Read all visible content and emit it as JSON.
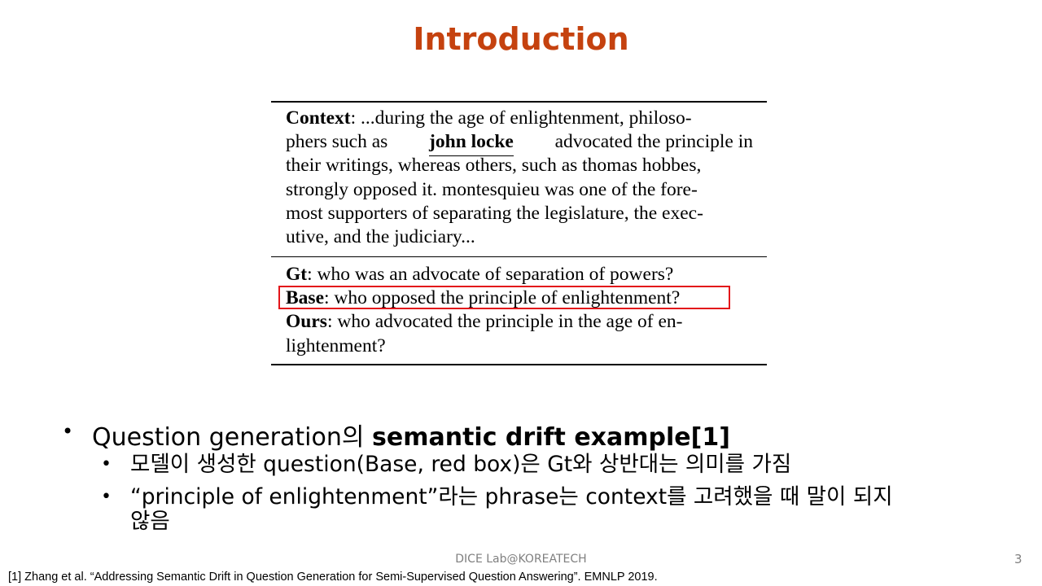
{
  "slide": {
    "title": "Introduction",
    "footer": "DICE Lab@KOREATECH",
    "page_number": "3",
    "reference": "[1] Zhang et al. “Addressing Semantic Drift in Question Generation for Semi-Supervised Question Answering”. EMNLP 2019."
  },
  "figure": {
    "context_label": "Context",
    "context_lines": [
      ": ...during the age of enlightenment, philoso-",
      "phers such as",
      "john locke",
      "advocated the principle in",
      "their writings, whereas others, such as thomas hobbes,",
      "strongly opposed it. montesquieu was one of the fore-",
      "most supporters of separating the legislature, the exec-",
      "utive, and the judiciary..."
    ],
    "gt_label": "Gt",
    "gt_text": ": who was an advocate of separation of powers?",
    "base_label": "Base",
    "base_text": ": who opposed the principle of enlightenment?",
    "ours_label": "Ours",
    "ours_text_line1": ": who advocated the principle in the age of en-",
    "ours_text_line2": "lightenment?",
    "highlight_color": "#e3151a"
  },
  "bullets": {
    "main": {
      "prefix": "Question generation의 ",
      "bold": "semantic drift example[1]"
    },
    "sub": [
      "모델이 생성한 question(Base, red box)은 Gt와 상반대는 의미를 가짐",
      "“principle of enlightenment”라는 phrase는 context를 고려했을 때 말이 되지",
      "않음"
    ]
  },
  "colors": {
    "title": "#c5420f",
    "footer": "#7f7f7f"
  }
}
